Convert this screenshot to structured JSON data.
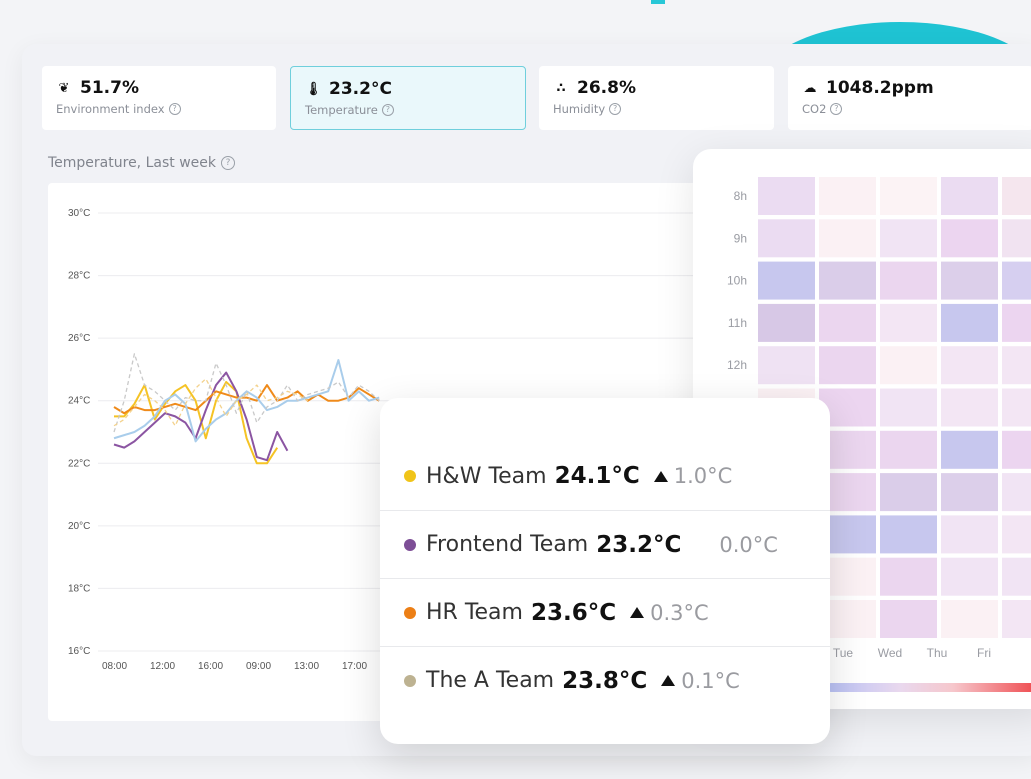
{
  "stats": [
    {
      "icon": "leaf-icon",
      "glyph": "❦",
      "value": "51.7%",
      "label": "Environment index"
    },
    {
      "icon": "thermometer-icon",
      "glyph": "🌡",
      "value": "23.2°C",
      "label": "Temperature"
    },
    {
      "icon": "droplets-icon",
      "glyph": "∴",
      "value": "26.8%",
      "label": "Humidity"
    },
    {
      "icon": "cloud-icon",
      "glyph": "☁",
      "value": "1048.2ppm",
      "label": "CO2"
    }
  ],
  "chart_title": "Temperature, Last week",
  "chart_data": {
    "type": "line",
    "yticks": [
      "30°C",
      "28°C",
      "26°C",
      "24°C",
      "22°C",
      "20°C",
      "18°C",
      "16°C"
    ],
    "ylim": [
      16,
      30
    ],
    "xticks": [
      "08:00",
      "12:00",
      "16:00",
      "09:00",
      "13:00",
      "17:00"
    ],
    "series": [
      {
        "color": "#f5c325",
        "values": [
          23.5,
          23.5,
          23.9,
          24.5,
          23.4,
          23.9,
          24.3,
          24.5,
          24.0,
          22.8,
          24.0,
          24.6,
          24.3,
          22.8,
          22.0,
          22.0,
          22.5
        ]
      },
      {
        "color": "#8b55a2",
        "values": [
          22.6,
          22.5,
          22.7,
          23.0,
          23.3,
          23.6,
          23.5,
          23.3,
          22.8,
          23.7,
          24.5,
          24.9,
          24.3,
          23.4,
          22.2,
          22.1,
          23.0,
          22.4
        ]
      },
      {
        "color": "#ef8a1a",
        "values": [
          23.8,
          23.6,
          23.8,
          23.7,
          23.7,
          23.8,
          23.9,
          23.8,
          23.7,
          24.0,
          24.3,
          24.2,
          24.1,
          24.1,
          24.0,
          24.5,
          24.0,
          24.1,
          24.3,
          24.0,
          24.2,
          24.0,
          24.0,
          24.1,
          24.4,
          24.2,
          24.0
        ]
      },
      {
        "color": "#a9cdeb",
        "values": [
          22.8,
          22.9,
          23.0,
          23.2,
          23.5,
          24.0,
          24.2,
          23.9,
          22.7,
          23.1,
          23.4,
          23.6,
          24.0,
          24.3,
          24.1,
          23.7,
          23.8,
          24.0,
          24.0,
          24.1,
          24.2,
          24.3,
          25.3,
          24.0,
          24.3,
          24.0,
          24.1
        ]
      },
      {
        "color": "#c9c9c9",
        "dashed": true,
        "values": [
          23.0,
          24.0,
          25.5,
          24.5,
          24.3,
          24.0,
          23.7,
          24.1,
          24.0,
          24.0,
          25.2,
          24.5,
          23.6,
          24.3,
          23.3,
          23.8,
          24.0,
          24.5,
          24.0,
          24.2,
          24.3,
          24.4,
          24.6,
          24.1,
          24.5,
          24.3,
          24.0
        ]
      },
      {
        "color": "#f3d28d",
        "dashed": true,
        "values": [
          23.2,
          23.4,
          23.8,
          24.2,
          24.0,
          23.7,
          23.2,
          23.9,
          24.4,
          24.7,
          24.1,
          23.5,
          24.0,
          24.2,
          24.5,
          24.0,
          24.1,
          24.3,
          24.2,
          24.0
        ]
      }
    ]
  },
  "heatmap": {
    "hours": [
      "8h",
      "9h",
      "10h",
      "11h",
      "12h"
    ],
    "days": [
      "Tue",
      "Wed",
      "Thu",
      "Fri"
    ],
    "colors": [
      [
        "#ebdcf2",
        "#fbf1f4",
        "#fcf3f5",
        "#ebdcf2",
        "#f5e6ee"
      ],
      [
        "#ebdcf2",
        "#fbf1f4",
        "#f1e4f4",
        "#ecd5f0",
        "#f1e3f1"
      ],
      [
        "#c7c7ee",
        "#dacde9",
        "#ebd6ef",
        "#dccfea",
        "#d6cff0"
      ],
      [
        "#d7c8e6",
        "#ebd6ef",
        "#f3e6f4",
        "#c7c7ee",
        "#ecd5f0"
      ],
      [
        "#efe2f3",
        "#ebd6ef",
        "#fbf1f4",
        "#f3e6f4",
        "#f3e6f4"
      ],
      [
        "#fbf1f4",
        "#ecd5f0",
        "#f1e4f4",
        "#f3e6f4",
        "#f3e6f4"
      ],
      [
        "#f3e6f4",
        "#ebd6ef",
        "#ebd6ef",
        "#c7c7ee",
        "#ecd5f0"
      ],
      [
        "#f3e6f4",
        "#ebd6ef",
        "#dacde9",
        "#dccfea",
        "#f1e4f4"
      ],
      [
        "#c7c7ee",
        "#c7c7ee",
        "#c7c7ee",
        "#f1e4f4",
        "#f3e6f4"
      ],
      [
        "#fbf1f4",
        "#fbf1f4",
        "#ebd6ef",
        "#f1e4f4",
        "#f1e4f4"
      ],
      [
        "#fbf1f4",
        "#fbf1f4",
        "#ebd6ef",
        "#fbf1f4",
        "#f3e6f4"
      ]
    ]
  },
  "tooltip": [
    {
      "color": "#f0c419",
      "name": "H&W Team",
      "value": "24.1°C",
      "up": true,
      "delta": "1.0°C"
    },
    {
      "color": "#7d4e96",
      "name": "Frontend Team",
      "value": "23.2°C",
      "up": false,
      "delta": "0.0°C"
    },
    {
      "color": "#ec7f16",
      "name": "HR Team",
      "value": "23.6°C",
      "up": true,
      "delta": "0.3°C"
    },
    {
      "color": "#bdb291",
      "name": "The A Team",
      "value": "23.8°C",
      "up": true,
      "delta": "0.1°C"
    }
  ]
}
